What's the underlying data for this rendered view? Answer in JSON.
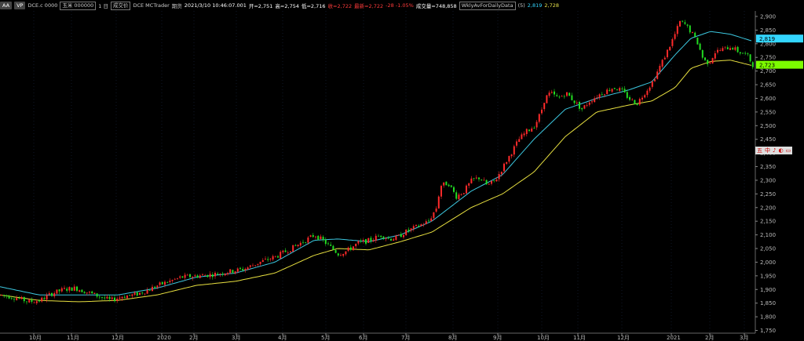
{
  "header": {
    "symbol_chip": "AA",
    "vp_chip": "VP",
    "contract": "DCE.c 0000",
    "name": "玉米 000000",
    "period": "1 日",
    "volume_label": "成交价",
    "exchange": "DCE MCTrader",
    "futures": "期货",
    "datetime": "2021/3/10 10:46:07.001",
    "open": "开=2,751",
    "high": "高=2,754",
    "low": "低=2,716",
    "close": "收=2,722",
    "last": "最新=2,722",
    "change": "-28 -1.05%",
    "turnover": "成交量=748,858",
    "study": "WklyAvForDailyData",
    "param": "(5)",
    "ma1_value": "2,819",
    "ma2_value": "2,728"
  },
  "colors": {
    "up": "#ff2a2a",
    "down": "#22dd22",
    "ma1": "#3cc8e0",
    "ma2": "#e8e040",
    "cyan_tag": "#33d6ff",
    "green_tag": "#7cfc00"
  },
  "side_buttons": [
    "五",
    "中",
    "♪",
    "◐",
    "▭"
  ],
  "chart_data": {
    "type": "candlestick",
    "y_ticks": [
      "2,900",
      "2,850",
      "2,800",
      "2,750",
      "2,700",
      "2,650",
      "2,600",
      "2,550",
      "2,500",
      "2,450",
      "2,400",
      "2,350",
      "2,300",
      "2,250",
      "2,200",
      "2,150",
      "2,100",
      "2,050",
      "2,000",
      "1,950",
      "1,900",
      "1,850",
      "1,800",
      "1,750"
    ],
    "y_range": [
      1740,
      2920
    ],
    "tag_values": [
      "2,819",
      "2,723"
    ],
    "x_ticks": [
      "10月",
      "11月",
      "12月",
      "2020",
      "2月",
      "3月",
      "4月",
      "5月",
      "6月",
      "7月",
      "8月",
      "9月",
      "10月",
      "11月",
      "12月",
      "2021",
      "2月",
      "3月"
    ],
    "close_anchors": [
      [
        0,
        1880
      ],
      [
        20,
        1870
      ],
      [
        35,
        1855
      ],
      [
        50,
        1860
      ],
      [
        65,
        1885
      ],
      [
        80,
        1900
      ],
      [
        95,
        1905
      ],
      [
        110,
        1890
      ],
      [
        125,
        1875
      ],
      [
        140,
        1860
      ],
      [
        155,
        1875
      ],
      [
        170,
        1880
      ],
      [
        185,
        1895
      ],
      [
        200,
        1915
      ],
      [
        215,
        1930
      ],
      [
        230,
        1945
      ],
      [
        250,
        1950
      ],
      [
        270,
        1955
      ],
      [
        290,
        1965
      ],
      [
        310,
        1975
      ],
      [
        330,
        2000
      ],
      [
        350,
        2020
      ],
      [
        370,
        2050
      ],
      [
        385,
        2075
      ],
      [
        400,
        2100
      ],
      [
        410,
        2080
      ],
      [
        420,
        2055
      ],
      [
        430,
        2030
      ],
      [
        440,
        2040
      ],
      [
        455,
        2070
      ],
      [
        470,
        2080
      ],
      [
        485,
        2100
      ],
      [
        495,
        2085
      ],
      [
        505,
        2090
      ],
      [
        515,
        2110
      ],
      [
        530,
        2130
      ],
      [
        545,
        2150
      ],
      [
        555,
        2200
      ],
      [
        560,
        2280
      ],
      [
        570,
        2290
      ],
      [
        580,
        2240
      ],
      [
        590,
        2260
      ],
      [
        600,
        2300
      ],
      [
        610,
        2310
      ],
      [
        620,
        2280
      ],
      [
        630,
        2300
      ],
      [
        640,
        2350
      ],
      [
        650,
        2400
      ],
      [
        660,
        2450
      ],
      [
        670,
        2480
      ],
      [
        680,
        2500
      ],
      [
        688,
        2550
      ],
      [
        693,
        2600
      ],
      [
        700,
        2620
      ],
      [
        710,
        2600
      ],
      [
        720,
        2620
      ],
      [
        730,
        2590
      ],
      [
        740,
        2560
      ],
      [
        750,
        2590
      ],
      [
        760,
        2610
      ],
      [
        770,
        2625
      ],
      [
        780,
        2640
      ],
      [
        790,
        2630
      ],
      [
        800,
        2600
      ],
      [
        810,
        2580
      ],
      [
        820,
        2620
      ],
      [
        830,
        2660
      ],
      [
        840,
        2720
      ],
      [
        850,
        2780
      ],
      [
        858,
        2830
      ],
      [
        865,
        2880
      ],
      [
        872,
        2870
      ],
      [
        880,
        2840
      ],
      [
        888,
        2800
      ],
      [
        895,
        2740
      ],
      [
        902,
        2730
      ],
      [
        910,
        2770
      ],
      [
        920,
        2780
      ],
      [
        930,
        2790
      ],
      [
        940,
        2770
      ],
      [
        950,
        2760
      ],
      [
        958,
        2722
      ]
    ],
    "ma1_anchors": [
      [
        0,
        1910
      ],
      [
        50,
        1880
      ],
      [
        100,
        1880
      ],
      [
        150,
        1880
      ],
      [
        200,
        1905
      ],
      [
        250,
        1945
      ],
      [
        300,
        1960
      ],
      [
        350,
        2000
      ],
      [
        400,
        2080
      ],
      [
        430,
        2085
      ],
      [
        470,
        2075
      ],
      [
        510,
        2100
      ],
      [
        550,
        2150
      ],
      [
        600,
        2260
      ],
      [
        640,
        2320
      ],
      [
        680,
        2450
      ],
      [
        720,
        2560
      ],
      [
        760,
        2600
      ],
      [
        800,
        2630
      ],
      [
        830,
        2660
      ],
      [
        860,
        2760
      ],
      [
        880,
        2820
      ],
      [
        905,
        2845
      ],
      [
        930,
        2835
      ],
      [
        958,
        2810
      ]
    ],
    "ma2_anchors": [
      [
        0,
        1880
      ],
      [
        50,
        1860
      ],
      [
        100,
        1855
      ],
      [
        150,
        1860
      ],
      [
        200,
        1880
      ],
      [
        250,
        1915
      ],
      [
        300,
        1930
      ],
      [
        350,
        1960
      ],
      [
        400,
        2025
      ],
      [
        430,
        2050
      ],
      [
        470,
        2045
      ],
      [
        510,
        2075
      ],
      [
        550,
        2110
      ],
      [
        600,
        2200
      ],
      [
        640,
        2250
      ],
      [
        680,
        2330
      ],
      [
        720,
        2460
      ],
      [
        760,
        2550
      ],
      [
        800,
        2575
      ],
      [
        830,
        2590
      ],
      [
        860,
        2640
      ],
      [
        880,
        2710
      ],
      [
        905,
        2735
      ],
      [
        930,
        2740
      ],
      [
        958,
        2720
      ]
    ]
  }
}
